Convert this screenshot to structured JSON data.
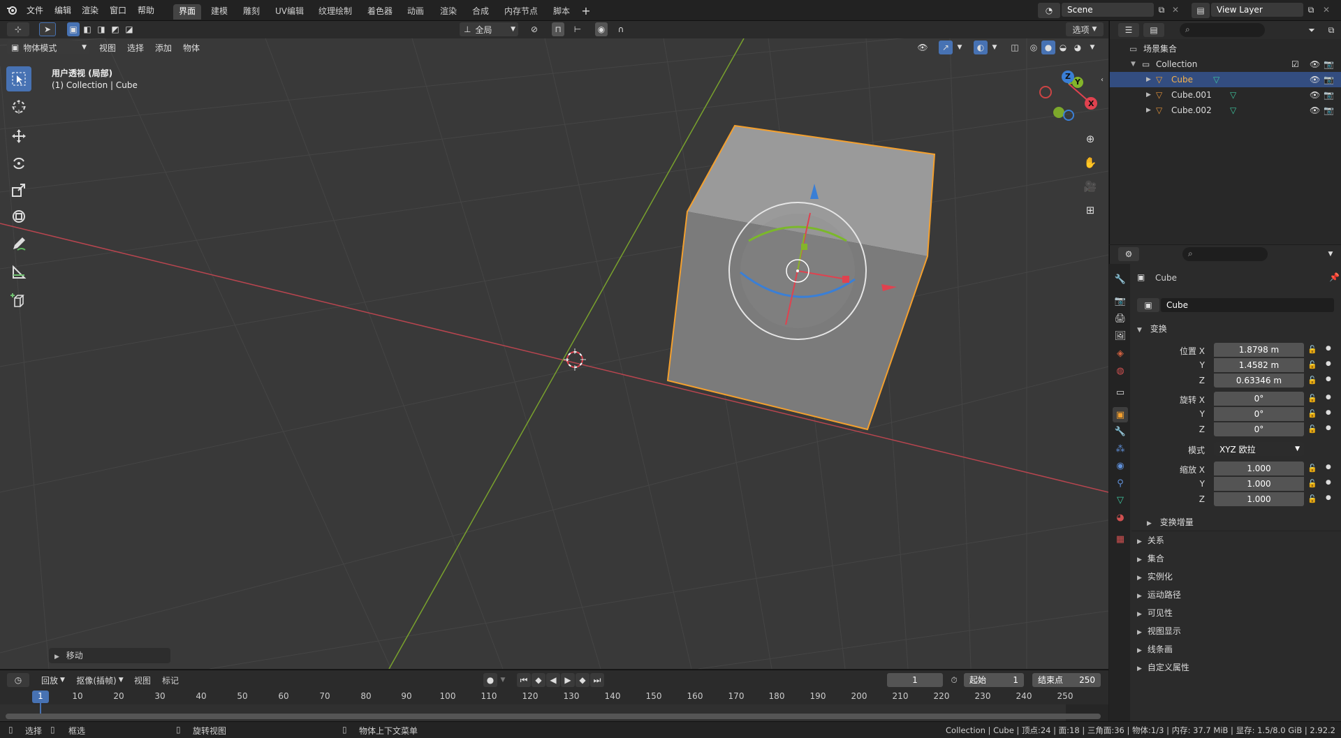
{
  "topbar": {
    "menus": [
      "文件",
      "编辑",
      "渲染",
      "窗口",
      "帮助"
    ],
    "workspaces": [
      "界面",
      "建模",
      "雕刻",
      "UV编辑",
      "纹理绘制",
      "着色器",
      "动画",
      "渲染",
      "合成",
      "内存节点",
      "脚本"
    ],
    "active_workspace": "界面",
    "scene": "Scene",
    "view_layer": "View Layer"
  },
  "viewport": {
    "mode": "物体模式",
    "menus": [
      "视图",
      "选择",
      "添加",
      "物体"
    ],
    "orientation": "全局",
    "options": "选项",
    "view_name": "用户透视 (局部)",
    "context": "(1) Collection | Cube",
    "last_op": "移动",
    "gizmo": {
      "x": "X",
      "y": "Y",
      "z": "Z"
    }
  },
  "outliner": {
    "root": "场景集合",
    "collection": "Collection",
    "objects": [
      "Cube",
      "Cube.001",
      "Cube.002"
    ],
    "selected": "Cube"
  },
  "properties": {
    "object_name": "Cube",
    "datablock_name": "Cube",
    "transform_panel": "变换",
    "location_label": "位置 X",
    "rotation_label": "旋转 X",
    "scale_label": "缩放 X",
    "mode_label": "模式",
    "axis_y": "Y",
    "axis_z": "Z",
    "location": [
      "1.8798 m",
      "1.4582 m",
      "0.63346 m"
    ],
    "rotation": [
      "0°",
      "0°",
      "0°"
    ],
    "rotation_mode": "XYZ 欧拉",
    "scale": [
      "1.000",
      "1.000",
      "1.000"
    ],
    "delta": "变换增量",
    "panels": [
      "关系",
      "集合",
      "实例化",
      "运动路径",
      "可见性",
      "视图显示",
      "线条画",
      "自定义属性"
    ]
  },
  "timeline": {
    "playback": "回放",
    "keying": "抠像(插帧)",
    "view": "视图",
    "marker": "标记",
    "current_frame": "1",
    "start_label": "起始",
    "start": "1",
    "end_label": "结束点",
    "end": "250",
    "ticks": [
      "1",
      "10",
      "20",
      "30",
      "40",
      "50",
      "60",
      "70",
      "80",
      "90",
      "100",
      "110",
      "120",
      "130",
      "140",
      "150",
      "160",
      "170",
      "180",
      "190",
      "200",
      "210",
      "220",
      "230",
      "240",
      "250"
    ]
  },
  "statusbar": {
    "select": "选择",
    "box": "框选",
    "rotate": "旋转视图",
    "context_menu": "物体上下文菜单",
    "stats": "Collection | Cube | 顶点:24 | 面:18 | 三角面:36 | 物体:1/3 | 内存: 37.7 MiB | 显存: 1.5/8.0 GiB | 2.92.2"
  },
  "colors": {
    "accent": "#4772b3",
    "selection": "#ffa030",
    "x_axis": "#e0424f",
    "y_axis": "#84b52a",
    "z_axis": "#3a7fd6"
  }
}
